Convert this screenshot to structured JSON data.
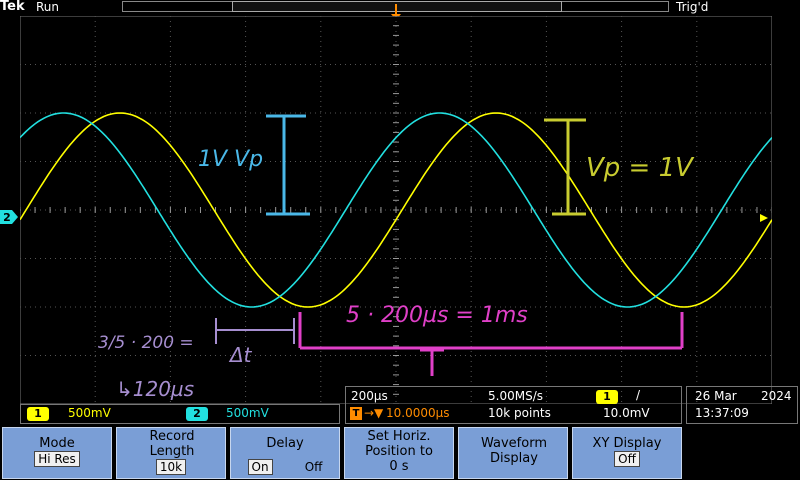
{
  "header": {
    "brand": "Tek",
    "run_state": "Run",
    "trigger_state": "Trig'd",
    "trigger_marker": "T"
  },
  "markers": {
    "ch2_ground": "2"
  },
  "channels": [
    {
      "number": "1",
      "scale": "500mV",
      "color": "#ffff00"
    },
    {
      "number": "2",
      "scale": "500mV",
      "color": "#22e0e0"
    }
  ],
  "horizontal": {
    "time_div": "200µs",
    "sample_rate": "5.00MS/s",
    "trigger_source": "1",
    "trigger_slope": "/",
    "trigger_position_prefix": "T",
    "trigger_position": "10.0000µs",
    "record_points": "10k points",
    "trigger_level": "10.0mV"
  },
  "datetime": {
    "date_day_month": "26 Mar",
    "year": "2024",
    "time": "13:37:09"
  },
  "annotations": {
    "cyan_label": "1V Vp",
    "yellow_label": "Vp = 1V",
    "period_eq": "5 · 200µs = 1ms",
    "period_symbol": "T",
    "phase_calc": "3/5 · 200 =",
    "phase_result": "↳120µs",
    "delta_t": "Δt"
  },
  "softkeys": [
    {
      "title": "Mode",
      "value": "Hi Res"
    },
    {
      "title": "Record Length",
      "value": "10k"
    },
    {
      "title": "Delay",
      "value_on": "On",
      "value_off": "Off"
    },
    {
      "title": "Set Horiz. Position to 0 s"
    },
    {
      "title": "Waveform Display"
    },
    {
      "title": "XY Display",
      "value": "Off"
    }
  ],
  "colors": {
    "ch1": "#ffff00",
    "ch2": "#22e0e0",
    "annotation_magenta": "#e040c8",
    "annotation_cyan": "#4ab8e8",
    "annotation_yellow": "#c8cc30",
    "annotation_purple": "#a68ed0",
    "softkey": "#7a9ed6",
    "trigger_orange": "#ff8c00"
  }
}
